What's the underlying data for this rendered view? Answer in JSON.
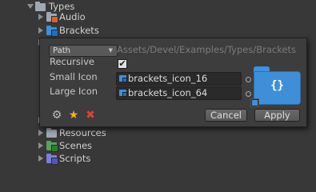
{
  "tree": {
    "root": {
      "label": "Types"
    },
    "items": [
      {
        "label": "Audio"
      },
      {
        "label": "Brackets"
      },
      {
        "label": "Resources"
      },
      {
        "label": "Scenes"
      },
      {
        "label": "Scripts"
      }
    ]
  },
  "popup": {
    "mode_dropdown": {
      "value": "Path"
    },
    "path_field": {
      "value": "Assets/Devel/Examples/Types/Brackets"
    },
    "recursive": {
      "label": "Recursive",
      "checked": true,
      "check_glyph": "✔"
    },
    "small_icon": {
      "label": "Small Icon",
      "value": "brackets_icon_16"
    },
    "large_icon": {
      "label": "Large Icon",
      "value": "brackets_icon_64"
    },
    "preview": {
      "glyph": "{}"
    },
    "toolbar": {
      "settings_glyph": "⚙",
      "favorite_glyph": "★",
      "remove_glyph": "✖"
    },
    "buttons": {
      "cancel": "Cancel",
      "apply": "Apply"
    }
  },
  "colors": {
    "background": "#383838",
    "folder_blue": "#3f8fd8",
    "star": "#f2b51a",
    "remove": "#e0402d"
  },
  "icons": [
    "folder-icon",
    "audio-folder-icon",
    "brackets-folder-icon",
    "resources-folder-icon",
    "scenes-folder-icon",
    "scripts-folder-icon",
    "gear-icon",
    "star-icon",
    "close-icon",
    "object-picker-icon",
    "checkbox-icon"
  ]
}
